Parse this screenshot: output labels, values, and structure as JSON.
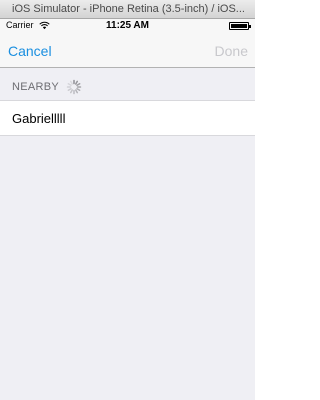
{
  "window": {
    "title": "iOS Simulator - iPhone Retina (3.5-inch) / iOS..."
  },
  "statusbar": {
    "carrier": "Carrier",
    "time": "11:25 AM"
  },
  "navbar": {
    "cancel_label": "Cancel",
    "done_label": "Done"
  },
  "section": {
    "header": "NEARBY"
  },
  "list": {
    "items": [
      {
        "label": "Gabrielllll"
      }
    ]
  },
  "colors": {
    "tint": "#1a8fe0",
    "disabled": "#c8c8cc",
    "background": "#efeff4"
  }
}
